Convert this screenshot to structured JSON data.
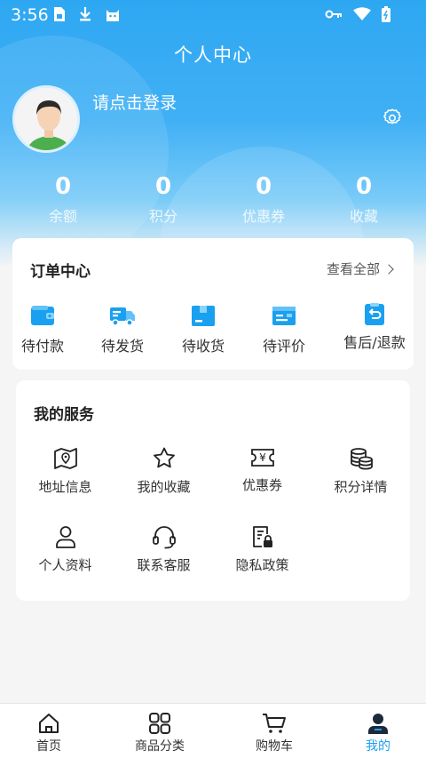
{
  "status_bar": {
    "time": "3:56"
  },
  "header": {
    "title": "个人中心"
  },
  "profile": {
    "login_prompt": "请点击登录"
  },
  "stats": [
    {
      "value": "0",
      "label": "余额"
    },
    {
      "value": "0",
      "label": "积分"
    },
    {
      "value": "0",
      "label": "优惠券"
    },
    {
      "value": "0",
      "label": "收藏"
    }
  ],
  "orders": {
    "title": "订单中心",
    "view_all": "查看全部",
    "items": [
      {
        "label": "待付款",
        "icon": "wallet-icon"
      },
      {
        "label": "待发货",
        "icon": "truck-icon"
      },
      {
        "label": "待收货",
        "icon": "box-icon"
      },
      {
        "label": "待评价",
        "icon": "review-icon"
      },
      {
        "label": "售后/退款",
        "icon": "refund-icon"
      }
    ]
  },
  "services": {
    "title": "我的服务",
    "items": [
      {
        "label": "地址信息",
        "icon": "map-icon"
      },
      {
        "label": "我的收藏",
        "icon": "star-icon"
      },
      {
        "label": "优惠券",
        "icon": "coupon-icon"
      },
      {
        "label": "积分详情",
        "icon": "coins-icon"
      },
      {
        "label": "个人资料",
        "icon": "user-icon"
      },
      {
        "label": "联系客服",
        "icon": "headset-icon"
      },
      {
        "label": "隐私政策",
        "icon": "privacy-doc-icon"
      }
    ]
  },
  "tabbar": {
    "items": [
      {
        "label": "首页",
        "icon": "home-icon"
      },
      {
        "label": "商品分类",
        "icon": "category-icon"
      },
      {
        "label": "购物车",
        "icon": "cart-icon"
      },
      {
        "label": "我的",
        "icon": "profile-icon",
        "active": true
      }
    ]
  },
  "colors": {
    "accent": "#1aa0f0",
    "header_top": "#2ea7f2",
    "background": "#f5f5f5"
  }
}
